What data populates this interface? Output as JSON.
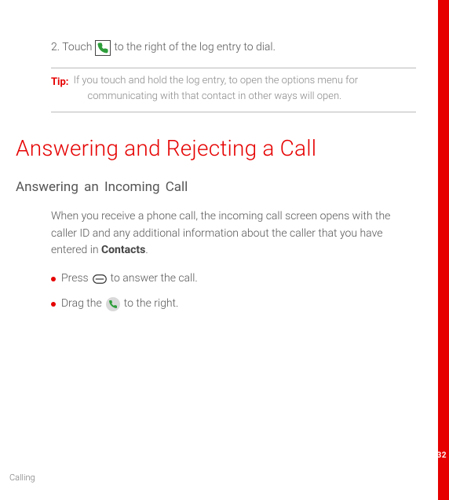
{
  "page": {
    "number": "32",
    "footer_label": "Calling"
  },
  "step": {
    "prefix": "2. Touch",
    "icon": "call-icon",
    "suffix": "to the right of the log entry to dial."
  },
  "tip": {
    "label": "Tip:",
    "text_line1": "If you touch and hold the log entry, to open the options menu for",
    "text_line2": "communicating with that contact in other ways will open."
  },
  "section": {
    "heading": "Answering and Rejecting a Call",
    "sub_heading": "Answering an Incoming Call",
    "paragraph_pre": "When you receive a phone call, the incoming call screen opens with the caller ID and any additional information about the caller that you have entered in ",
    "paragraph_bold": "Contacts",
    "paragraph_post": ".",
    "bullets": [
      {
        "pre": "Press",
        "icon": "answer-key-icon",
        "post": "to answer the call."
      },
      {
        "pre": "Drag the",
        "icon": "answer-circle-icon",
        "post": " to the right."
      }
    ]
  }
}
